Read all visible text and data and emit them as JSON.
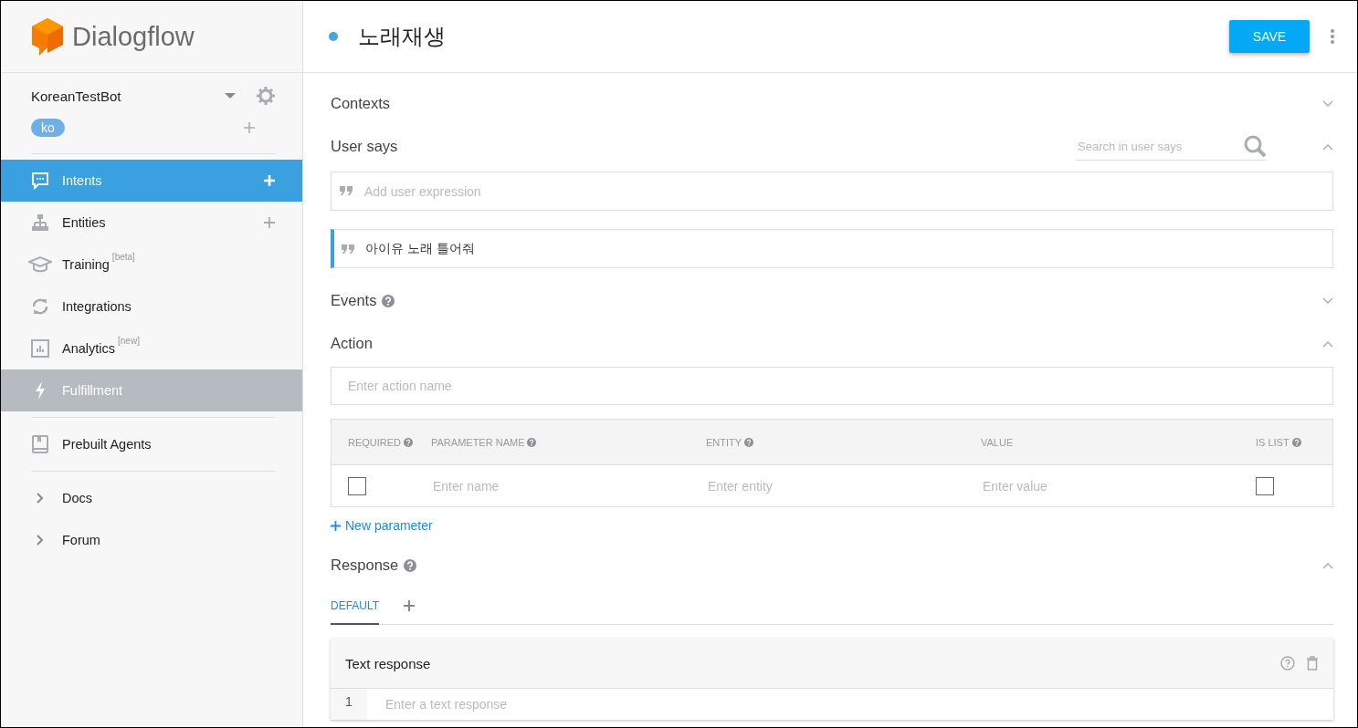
{
  "app": {
    "logo_text": "Dialogflow"
  },
  "agent": {
    "name": "KoreanTestBot",
    "language": "ko"
  },
  "nav_sections": [
    {
      "items": [
        {
          "kind": "page",
          "label": "Intents",
          "selected": true,
          "highlighted": false,
          "has_add": true
        },
        {
          "kind": "page",
          "label": "Entities",
          "selected": false,
          "highlighted": false,
          "has_add": true
        },
        {
          "kind": "page",
          "label": "Training",
          "tag": "[beta]",
          "selected": false,
          "highlighted": false,
          "has_add": false
        },
        {
          "kind": "page",
          "label": "Integrations",
          "selected": false,
          "highlighted": false,
          "has_add": false
        },
        {
          "kind": "page",
          "label": "Analytics",
          "tag": "[new]",
          "selected": false,
          "highlighted": false,
          "has_add": false
        },
        {
          "kind": "page",
          "label": "Fulfillment",
          "selected": false,
          "highlighted": true,
          "has_add": false
        }
      ]
    },
    {
      "items": [
        {
          "kind": "page",
          "label": "Prebuilt Agents",
          "selected": false,
          "highlighted": false,
          "has_add": false
        }
      ]
    },
    {
      "items": [
        {
          "kind": "link",
          "label": "Docs",
          "selected": false,
          "highlighted": false,
          "has_add": false
        },
        {
          "kind": "link",
          "label": "Forum",
          "selected": false,
          "highlighted": false,
          "has_add": false
        }
      ]
    }
  ],
  "intent": {
    "title": "노래재생",
    "save_button": "SAVE"
  },
  "contexts": {
    "label": "Contexts",
    "expanded": false
  },
  "user_says": {
    "label": "User says",
    "expanded": true,
    "search_placeholder": "Search in user says",
    "input_placeholder": "Add user expression",
    "expressions": [
      "아이유 노래 틀어줘"
    ]
  },
  "events": {
    "label": "Events",
    "help": true,
    "expanded": false
  },
  "action": {
    "label": "Action",
    "expanded": true,
    "placeholder": "Enter action name",
    "columns": [
      {
        "label": "REQUIRED",
        "help": true
      },
      {
        "label": "PARAMETER NAME",
        "help": true
      },
      {
        "label": "ENTITY",
        "help": true
      },
      {
        "label": "VALUE",
        "help": false
      },
      {
        "label": "IS LIST",
        "help": true
      }
    ],
    "rows": [
      {
        "required": false,
        "name_placeholder": "Enter name",
        "entity_placeholder": "Enter entity",
        "value_placeholder": "Enter value",
        "is_list": false
      }
    ],
    "add_link": "New parameter"
  },
  "response": {
    "label": "Response",
    "help": true,
    "expanded": true,
    "tabs": [
      {
        "label": "DEFAULT",
        "selected": true
      }
    ],
    "cards": [
      {
        "title": "Text response",
        "lines": [
          {
            "number": "1",
            "placeholder": "Enter a text response"
          }
        ]
      }
    ]
  }
}
